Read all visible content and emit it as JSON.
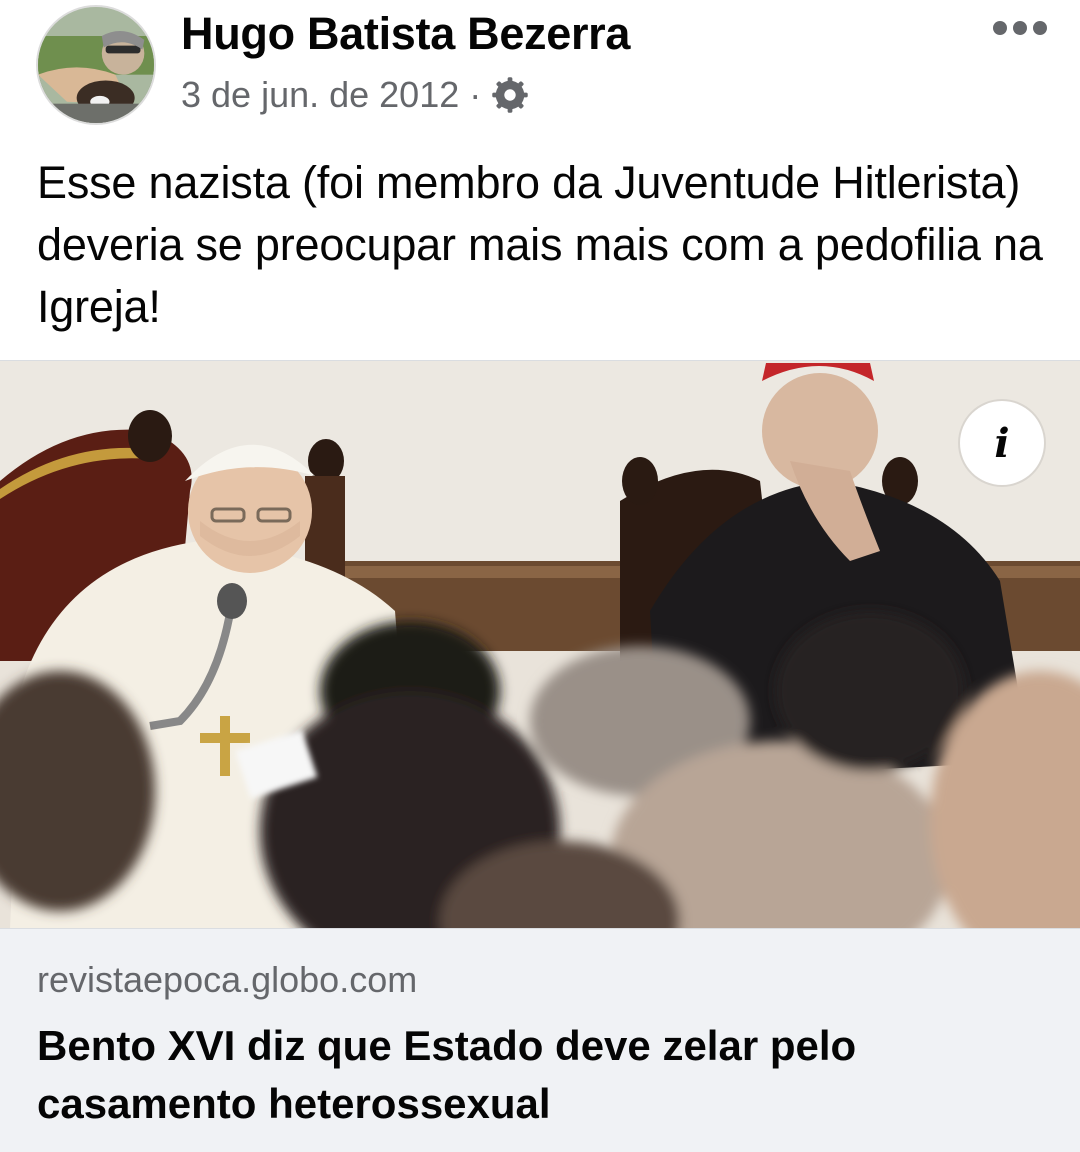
{
  "post": {
    "author": "Hugo Batista Bezerra",
    "date": "3 de jun. de 2012",
    "separator": "·",
    "privacy_icon": "gear-icon",
    "more_icon": "more-options-icon",
    "text": "Esse nazista (foi membro da Juventude Hitlerista) deveria se preocupar mais mais com a pedofilia na Igreja!"
  },
  "link_preview": {
    "domain": "revistaepoca.globo.com",
    "title": "Bento XVI diz que Estado deve zelar pelo casamento heterossexual",
    "info_icon": "info-icon",
    "info_glyph": "i"
  },
  "colors": {
    "text_primary": "#050505",
    "text_secondary": "#65676b",
    "footer_background": "#f0f2f5"
  }
}
